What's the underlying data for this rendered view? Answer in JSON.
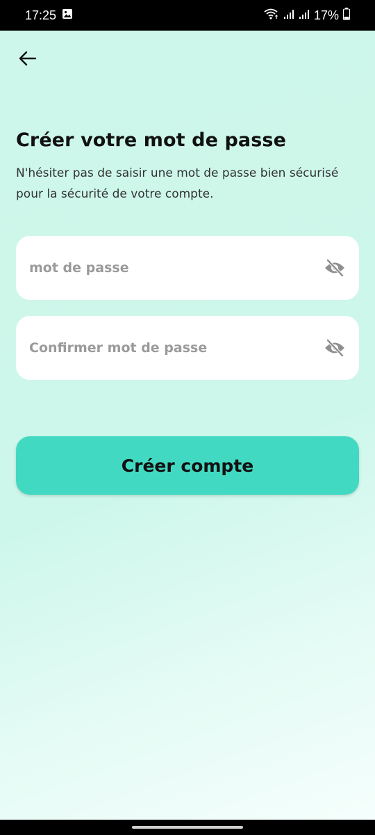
{
  "status_bar": {
    "time": "17:25",
    "battery": "17%",
    "icons": [
      "gallery-notification-icon",
      "wifi-icon",
      "signal-icon",
      "battery-icon"
    ]
  },
  "header": {
    "back_icon": "arrow-left-icon"
  },
  "main": {
    "title": "Créer votre mot de passe",
    "subtitle": "N'hésiter pas de saisir une mot de passe bien sécurisé pour la sécurité de votre compte.",
    "password_field": {
      "placeholder": "mot de passe",
      "value": "",
      "toggle_icon": "eye-off-icon"
    },
    "confirm_field": {
      "placeholder": "Confirmer mot de passe",
      "value": "",
      "toggle_icon": "eye-off-icon"
    },
    "submit_label": "Créer compte"
  },
  "colors": {
    "background": "#CEF7EB",
    "button": "#42D9C2",
    "field": "#FFFFFF",
    "placeholder": "#9A9A9A"
  }
}
